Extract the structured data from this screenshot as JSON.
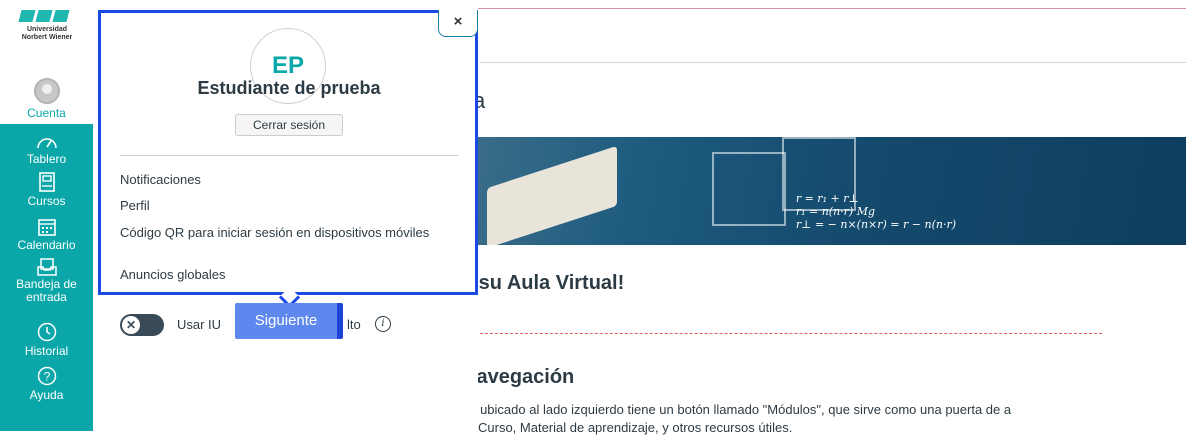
{
  "brand": {
    "line1": "Universidad",
    "line2": "Norbert Wiener"
  },
  "global_nav": {
    "account": "Cuenta",
    "items": [
      {
        "label": "Tablero",
        "icon": "dashboard-icon"
      },
      {
        "label": "Cursos",
        "icon": "courses-icon"
      },
      {
        "label": "Calendario",
        "icon": "calendar-icon"
      },
      {
        "label": "Bandeja de entrada",
        "icon": "inbox-icon"
      },
      {
        "label": "Historial",
        "icon": "history-icon"
      },
      {
        "label": "Ayuda",
        "icon": "help-icon"
      }
    ]
  },
  "tray": {
    "initials": "EP",
    "user_name": "Estudiante de prueba",
    "logout": "Cerrar sesión",
    "close": "×",
    "links": [
      "Notificaciones",
      "Perfil",
      "Código QR para iniciar sesión en dispositivos móviles",
      "Anuncios globales"
    ],
    "toggle_label_a": "Usar IU",
    "toggle_label_b": "lto",
    "toggle_state": "off"
  },
  "tour": {
    "next": "Siguiente"
  },
  "main": {
    "title_fragment": "ca",
    "welcome_fragment": "a su Aula Virtual!",
    "nav_heading_fragment": "Navegación",
    "para_line1": "ón ubicado al lado izquierdo tiene un botón llamado \"Módulos\", que sirve como una puerta de a",
    "para_line2": "Curso, Material de aprendizaje, y otros recursos útiles.",
    "banner_formula": [
      "r = r₁ + r⊥",
      "r₁ = n(n·r)   Mg",
      "r⊥ = − n×(n×r) = r − n(n·r)"
    ]
  }
}
